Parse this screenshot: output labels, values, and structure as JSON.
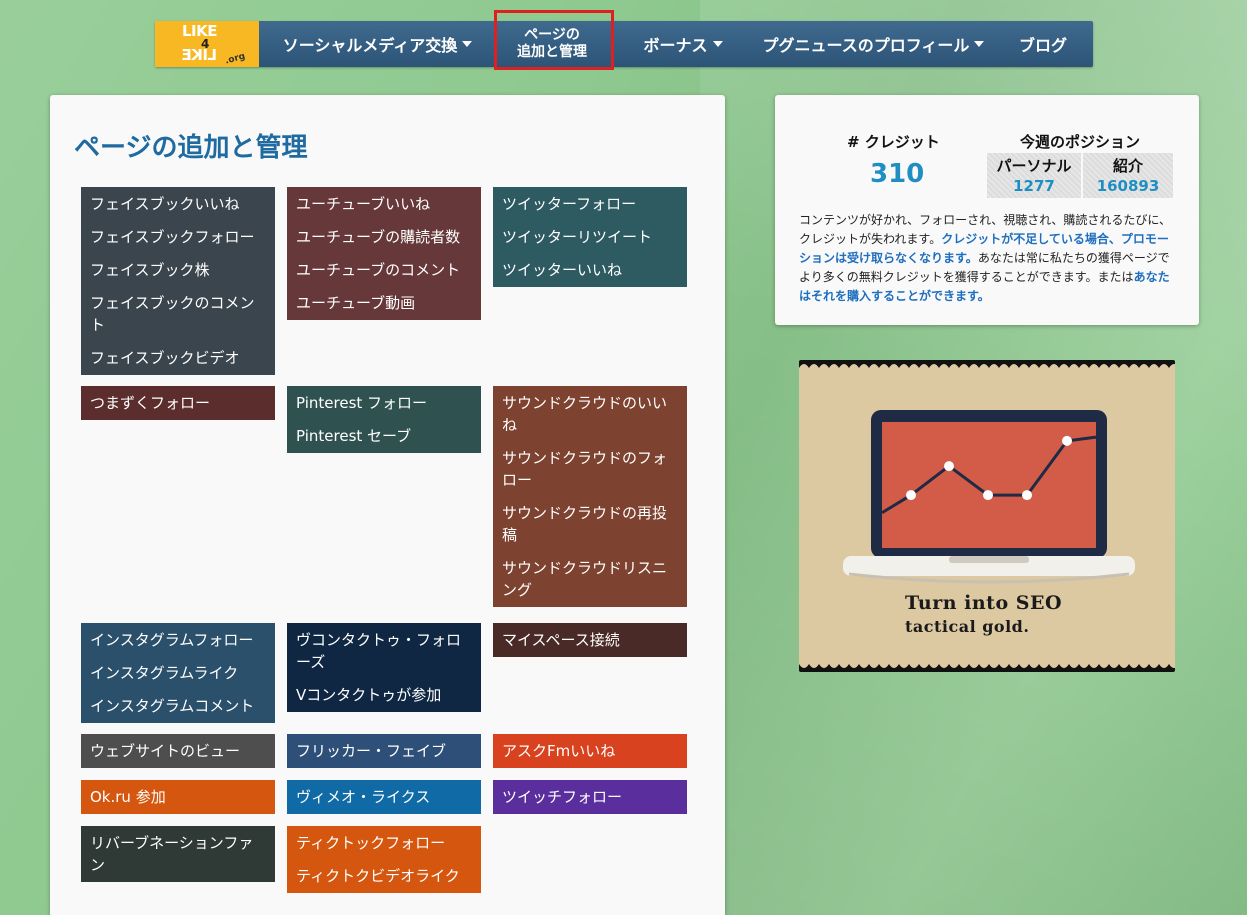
{
  "colors": {
    "background": "#8ec98f",
    "nav": "#355f83",
    "logo_bg": "#f7b824",
    "title": "#1f6aa0",
    "credit_value": "#1f8fc3",
    "link": "#1e6fbf",
    "highlight": "#e02020"
  },
  "logo": {
    "top": "LIKE",
    "mid": "4",
    "bottom": "LIKE",
    "suffix": ".org"
  },
  "nav": {
    "items": [
      {
        "label": "ソーシャルメディア交換",
        "dropdown": true
      },
      {
        "line1": "ページの",
        "line2": "追加と管理",
        "dropdown": false,
        "highlighted": true
      },
      {
        "label": "ボーナス",
        "dropdown": true
      },
      {
        "label": "プグニュースのプロフィール",
        "dropdown": true
      },
      {
        "label": "ブログ",
        "dropdown": false
      }
    ]
  },
  "main": {
    "title": "ページの追加と管理",
    "tiles": [
      {
        "color": "#3a454d",
        "items": [
          "フェイスブックいいね",
          "フェイスブックフォロー",
          "フェイスブック株",
          "フェイスブックのコメント",
          "フェイスブックビデオ"
        ]
      },
      {
        "color": "#66383a",
        "items": [
          "ユーチューブいいね",
          "ユーチューブの購読者数",
          "ユーチューブのコメント",
          "ユーチューブ動画"
        ]
      },
      {
        "color": "#2e5a62",
        "items": [
          "ツイッターフォロー",
          "ツイッターリツイート",
          "ツイッターいいね"
        ]
      },
      {
        "color": "#5c2d2d",
        "items": [
          "つまずくフォロー"
        ]
      },
      {
        "color": "#2f5250",
        "items": [
          "Pinterest フォロー",
          "Pinterest セーブ"
        ]
      },
      {
        "color": "#7e4230",
        "items": [
          "サウンドクラウドのいいね",
          "サウンドクラウドのフォロー",
          "サウンドクラウドの再投稿",
          "サウンドクラウドリスニング"
        ]
      },
      {
        "color": "#2b506b",
        "items": [
          "インスタグラムフォロー",
          "インスタグラムライク",
          "インスタグラムコメント"
        ]
      },
      {
        "color": "#0f2742",
        "items": [
          "ヴコンタクトゥ・フォローズ",
          "Vコンタクトゥが参加"
        ]
      },
      {
        "color": "#4a2a26",
        "items": [
          "マイスペース接続"
        ]
      },
      {
        "color": "#4e4e4e",
        "items": [
          "ウェブサイトのビュー"
        ]
      },
      {
        "color": "#2e4f78",
        "items": [
          "フリッカー・フェイブ"
        ]
      },
      {
        "color": "#d9421f",
        "items": [
          "アスクFmいいね"
        ]
      },
      {
        "color": "#d5560e",
        "items": [
          "Ok.ru 参加"
        ]
      },
      {
        "color": "#0f6aa6",
        "items": [
          "ヴィメオ・ライクス"
        ]
      },
      {
        "color": "#5a2e9d",
        "items": [
          "ツイッチフォロー"
        ]
      },
      {
        "color": "#2f3a36",
        "items": [
          "リバーブネーションファン"
        ]
      },
      {
        "color": "#d5560e",
        "items": [
          "ティクトックフォロー",
          "ティクトクビデオライク"
        ]
      }
    ]
  },
  "side": {
    "credits_label": "# クレジット",
    "credits_value": "310",
    "week_label": "今週のポジション",
    "personal_label": "パーソナル",
    "personal_value": "1277",
    "referral_label": "紹介",
    "referral_value": "160893",
    "desc1": "コンテンツが好かれ、フォローされ、視聴され、購読されるたびに、クレジットが失われます。",
    "desc_link1": "クレジットが不足している場合、プロモーションは受け取らなくなります。",
    "desc2": "あなたは常に私たちの獲得ページでより多くの無料クレジットを獲得することができます。または",
    "desc_link2": "あなたはそれを購入することができます。"
  },
  "ad": {
    "line1": "Turn into SEO",
    "line2": "tactical gold.",
    "chart_points": [
      0.28,
      0.42,
      0.65,
      0.42,
      0.42,
      0.85,
      0.88
    ]
  }
}
